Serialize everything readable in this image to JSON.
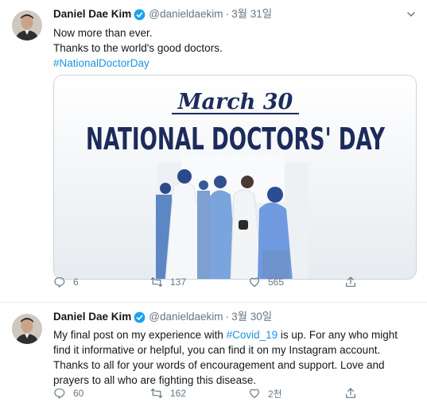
{
  "tweets": [
    {
      "name": "Daniel Dae Kim",
      "handle": "@danieldaekim",
      "separator": "·",
      "time": "3월 31일",
      "text_lines": [
        "Now more than ever.",
        "Thanks to the world's good doctors."
      ],
      "hashtag": "#NationalDoctorDay",
      "media": {
        "script_line": "March 30",
        "headline": "NATIONAL DOCTORS' DAY"
      },
      "counts": {
        "replies": "6",
        "retweets": "137",
        "likes": "565"
      }
    },
    {
      "name": "Daniel Dae Kim",
      "handle": "@danieldaekim",
      "separator": "·",
      "time": "3월 30일",
      "text_lines": [
        "My final post on my experience with ",
        "#Covid_19",
        " is up. For any who might find it informative or helpful, you can find it on my Instagram account. Thanks to all for your words of encouragement and support. Love and prayers to all who are fighting this disease."
      ],
      "counts": {
        "replies": "60",
        "retweets": "162",
        "likes": "2천"
      }
    }
  ],
  "colors": {
    "accent": "#1b95e0",
    "verified": "#1da1f2",
    "muted": "#657786",
    "headline": "#1d2b5c"
  },
  "icons": [
    "verified-badge-icon",
    "chevron-down-icon",
    "reply-icon",
    "retweet-icon",
    "like-icon",
    "share-icon"
  ]
}
